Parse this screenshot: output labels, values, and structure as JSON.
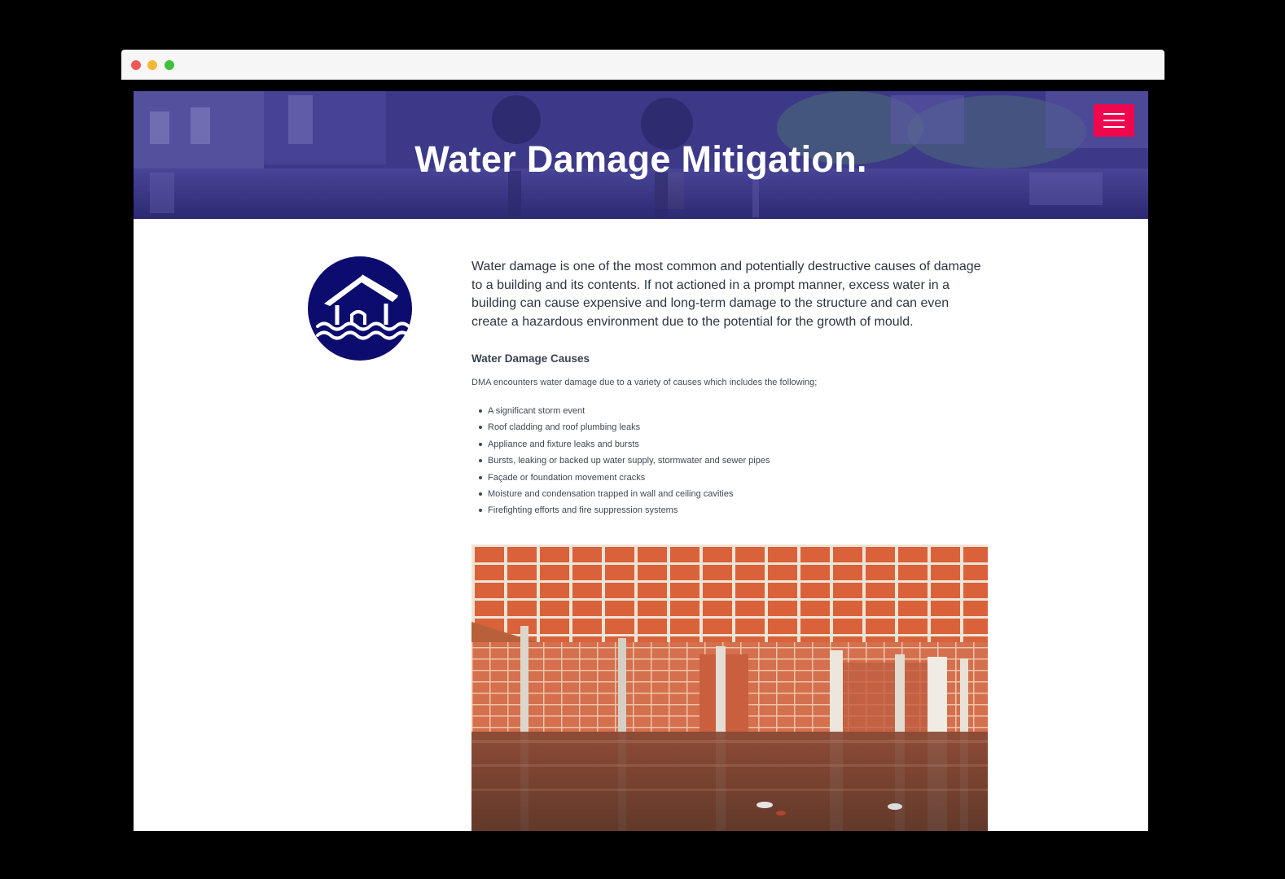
{
  "browser": {
    "controls": [
      "close",
      "minimize",
      "maximize"
    ]
  },
  "hero": {
    "title": "Water Damage Mitigation."
  },
  "nav": {
    "menu_icon": "hamburger-menu-icon",
    "accent_color": "#f0084f"
  },
  "service": {
    "icon": "flooded-house-icon",
    "icon_color": "#0c0c6e"
  },
  "article": {
    "intro": "Water damage is one of the most common and potentially destructive causes of damage to a building and its contents. If not actioned in a prompt manner, excess water in a building can cause expensive and long-term damage to the structure and can even create a hazardous environment due to the potential for the growth of mould.",
    "causes_heading": "Water Damage Causes",
    "causes_lead": "DMA encounters water damage due to a variety of causes which includes the following;",
    "causes": [
      "A significant storm event",
      "Roof cladding and roof plumbing leaks",
      "Appliance and fixture leaks and bursts",
      "Bursts, leaking or backed up water supply, stormwater and sewer pipes",
      "Façade or foundation movement cracks",
      "Moisture and condensation trapped in wall and ceiling cavities",
      "Firefighting efforts and fire suppression systems"
    ]
  },
  "photo": {
    "subject": "flooded-basement-photo"
  }
}
